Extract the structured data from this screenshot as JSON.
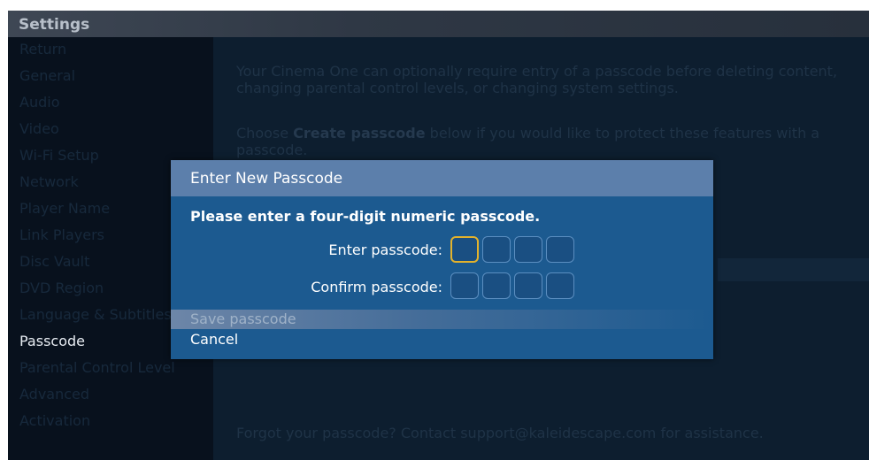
{
  "window": {
    "title": "Settings"
  },
  "sidebar": {
    "items": [
      {
        "label": "Return",
        "active": false
      },
      {
        "label": "General",
        "active": false
      },
      {
        "label": "Audio",
        "active": false
      },
      {
        "label": "Video",
        "active": false
      },
      {
        "label": "Wi-Fi Setup",
        "active": false
      },
      {
        "label": "Network",
        "active": false
      },
      {
        "label": "Player Name",
        "active": false
      },
      {
        "label": "Link Players",
        "active": false
      },
      {
        "label": "Disc Vault",
        "active": false
      },
      {
        "label": "DVD Region",
        "active": false
      },
      {
        "label": "Language & Subtitles",
        "active": false
      },
      {
        "label": "Passcode",
        "active": true
      },
      {
        "label": "Parental Control Level",
        "active": false
      },
      {
        "label": "Advanced",
        "active": false
      },
      {
        "label": "Activation",
        "active": false
      }
    ]
  },
  "main": {
    "intro": "Your Cinema One can optionally require entry of a passcode before deleting content, changing parental control levels, or changing system settings.",
    "choose_prefix": "Choose ",
    "choose_bold": "Create passcode",
    "choose_suffix": " below if you would like to protect these features with a passcode.",
    "forgot": "Forgot your passcode? Contact support@kaleidescape.com for assistance."
  },
  "dialog": {
    "title": "Enter New Passcode",
    "instruction": "Please enter a four-digit numeric passcode.",
    "enter_label": "Enter passcode:",
    "confirm_label": "Confirm passcode:",
    "save_label": "Save passcode",
    "cancel_label": "Cancel"
  },
  "colors": {
    "dialog_bg": "#1c5a90",
    "dialog_header": "#5c7fab",
    "focus_border": "#e3b22c",
    "screen_bg": "#0b1a2a"
  }
}
